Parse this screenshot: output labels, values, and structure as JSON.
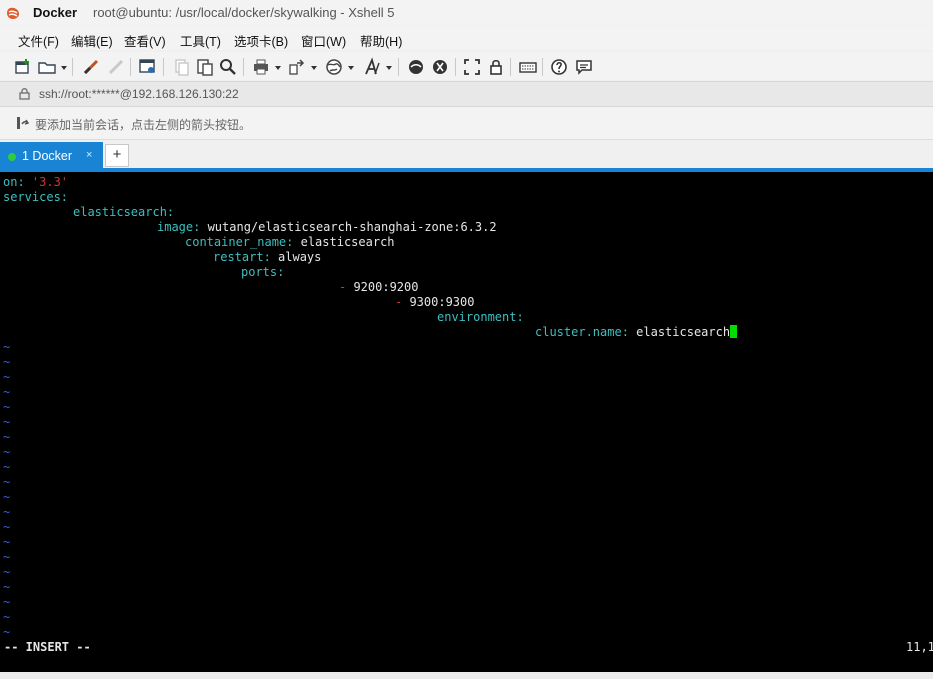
{
  "window": {
    "app_name": "Docker",
    "title_rest": "root@ubuntu: /usr/local/docker/skywalking - Xshell 5"
  },
  "menu": [
    "文件(F)",
    "编辑(E)",
    "查看(V)",
    "工具(T)",
    "选项卡(B)",
    "窗口(W)",
    "帮助(H)"
  ],
  "toolbar": {
    "icons": [
      "new-session-icon",
      "open-folder-icon",
      "connect-icon",
      "disconnect-icon",
      "session-properties-icon",
      "copy-icon",
      "paste-icon",
      "find-icon",
      "print-icon",
      "transfer-icon",
      "globe-icon",
      "font-icon",
      "xftp-icon",
      "xmanager-icon",
      "fullscreen-icon",
      "lock-icon",
      "keyboard-icon",
      "help-icon",
      "chat-icon"
    ]
  },
  "address": {
    "text": "ssh://root:******@192.168.126.130:22"
  },
  "hint": {
    "text": "要添加当前会话，点击左侧的箭头按钮。"
  },
  "tabs": [
    {
      "label": "1 Docker",
      "close": "×"
    }
  ],
  "add_tab": "+",
  "terminal": {
    "lines": [
      {
        "key": "on",
        "sep": ": ",
        "val": "'3.3'",
        "val_kind": "string"
      },
      {
        "key": "services",
        "sep": ":",
        "val": "",
        "val_kind": "plain"
      },
      {
        "key": "elasticsearch",
        "sep": ":",
        "val": "",
        "val_kind": "plain"
      },
      {
        "key": "image",
        "sep": ": ",
        "val": "wutang/elasticsearch-shanghai-zone:6.3.2",
        "val_kind": "plain"
      },
      {
        "key": "container_name",
        "sep": ": ",
        "val": "elasticsearch",
        "val_kind": "plain"
      },
      {
        "key": "restart",
        "sep": ": ",
        "val": "always",
        "val_kind": "plain"
      },
      {
        "key": "ports",
        "sep": ":",
        "val": "",
        "val_kind": "plain"
      },
      {
        "key": "",
        "sep": "- ",
        "val": "9200:9200",
        "val_kind": "plain"
      },
      {
        "key": "",
        "sep": "- ",
        "val": "9300:9300",
        "val_kind": "plain"
      },
      {
        "key": "environment",
        "sep": ":",
        "val": "",
        "val_kind": "plain"
      },
      {
        "key": "cluster.name",
        "sep": ": ",
        "val": "elasticsearch",
        "val_kind": "plain"
      }
    ],
    "tilde": "~",
    "tilde_count": 20,
    "mode": "-- INSERT --",
    "cursor_pos": "11,1"
  },
  "colors": {
    "accent": "#1a84d4",
    "key": "#3dbfbf",
    "string": "#c23a3a",
    "tilde": "#3a5fd9",
    "cursor": "#00e000"
  }
}
